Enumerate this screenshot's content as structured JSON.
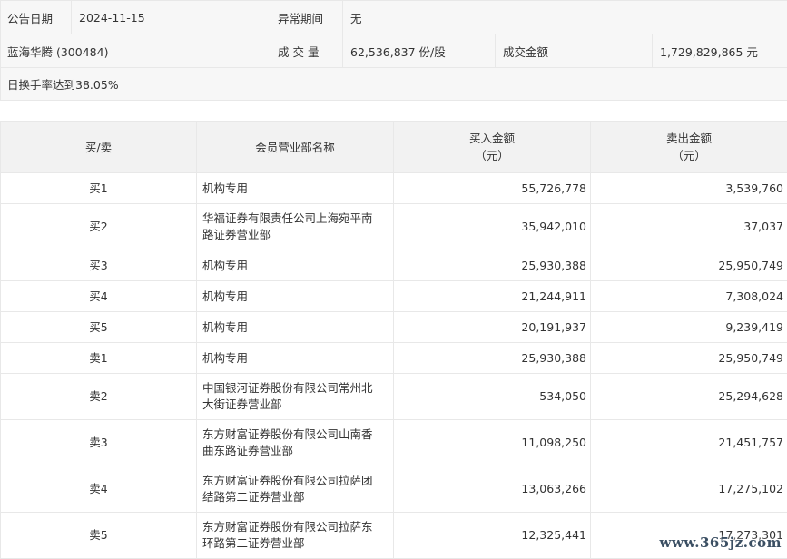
{
  "summary": {
    "announce_date_label": "公告日期",
    "announce_date_value": "2024-11-15",
    "abnormal_period_label": "异常期间",
    "abnormal_period_value": "无",
    "stock_name": "蓝海华腾 (300484)",
    "volume_label": "成 交 量",
    "volume_value": "62,536,837 份/股",
    "amount_label": "成交金额",
    "amount_value": "1,729,829,865 元",
    "reason": "日换手率达到38.05%"
  },
  "table": {
    "headers": {
      "side": "买/卖",
      "branch": "会员营业部名称",
      "buy_line1": "买入金额",
      "buy_line2": "（元）",
      "sell_line1": "卖出金额",
      "sell_line2": "（元）"
    },
    "rows": [
      {
        "side": "买1",
        "branch": "机构专用",
        "buy": "55,726,778",
        "sell": "3,539,760"
      },
      {
        "side": "买2",
        "branch": "华福证券有限责任公司上海宛平南路证券营业部",
        "buy": "35,942,010",
        "sell": "37,037"
      },
      {
        "side": "买3",
        "branch": "机构专用",
        "buy": "25,930,388",
        "sell": "25,950,749"
      },
      {
        "side": "买4",
        "branch": "机构专用",
        "buy": "21,244,911",
        "sell": "7,308,024"
      },
      {
        "side": "买5",
        "branch": "机构专用",
        "buy": "20,191,937",
        "sell": "9,239,419"
      },
      {
        "side": "卖1",
        "branch": "机构专用",
        "buy": "25,930,388",
        "sell": "25,950,749"
      },
      {
        "side": "卖2",
        "branch": "中国银河证券股份有限公司常州北大街证券营业部",
        "buy": "534,050",
        "sell": "25,294,628"
      },
      {
        "side": "卖3",
        "branch": "东方财富证券股份有限公司山南香曲东路证券营业部",
        "buy": "11,098,250",
        "sell": "21,451,757"
      },
      {
        "side": "卖4",
        "branch": "东方财富证券股份有限公司拉萨团结路第二证券营业部",
        "buy": "13,063,266",
        "sell": "17,275,102"
      },
      {
        "side": "卖5",
        "branch": "东方财富证券股份有限公司拉萨东环路第二证券营业部",
        "buy": "12,325,441",
        "sell": "17,273,301"
      }
    ]
  },
  "watermark": "www.365jz.com"
}
